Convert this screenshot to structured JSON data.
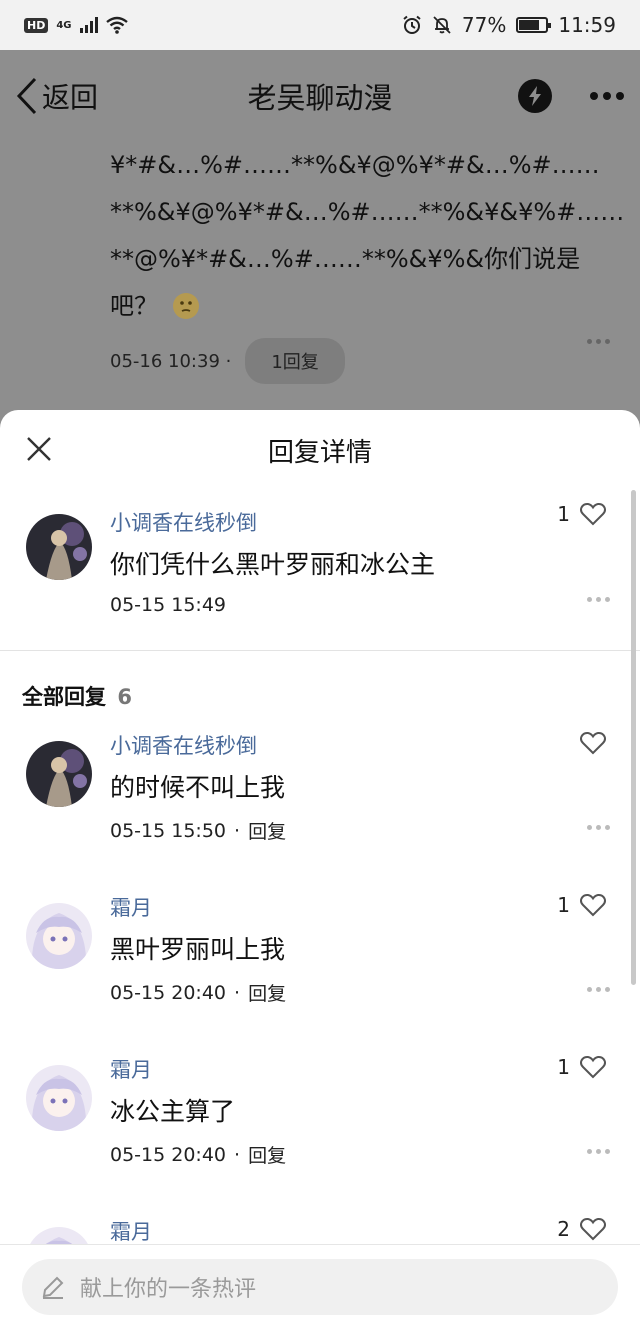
{
  "status_bar": {
    "hd": "HD",
    "net": "4G",
    "battery_percent": "77%",
    "battery_level": 0.77,
    "time": "11:59"
  },
  "topbar": {
    "back_label": "返回",
    "title": "老吴聊动漫"
  },
  "bg_comment": {
    "lines": [
      "¥*#&…%#……**%&¥@%¥*#&…%#……",
      "**%&¥@%¥*#&…%#……**%&¥&¥%#……",
      "**@%¥*#&…%#……**%&¥%&你们说是",
      "吧？"
    ],
    "time": "05-16 10:39",
    "reply_count": "1回复"
  },
  "sheet": {
    "title": "回复详情",
    "main_comment": {
      "username": "小调香在线秒倒",
      "text": "你们凭什么黑叶罗丽和冰公主",
      "time": "05-15 15:49",
      "likes": "1"
    },
    "section_label": "全部回复",
    "section_count": "6",
    "replies": [
      {
        "username": "小调香在线秒倒",
        "text": "的时候不叫上我",
        "time": "05-15 15:50",
        "reply_label": "回复",
        "likes": ""
      },
      {
        "username": "霜月",
        "text": "黑叶罗丽叫上我",
        "time": "05-15 20:40",
        "reply_label": "回复",
        "likes": "1"
      },
      {
        "username": "霜月",
        "text": "冰公主算了",
        "time": "05-15 20:40",
        "reply_label": "回复",
        "likes": "1"
      },
      {
        "username": "霜月",
        "text": "",
        "time": "",
        "reply_label": "",
        "likes": "2"
      }
    ]
  },
  "bottom": {
    "placeholder": "献上你的一条热评"
  },
  "colors": {
    "username": "#4a6a9a",
    "overlay": "#8e8e8e"
  }
}
